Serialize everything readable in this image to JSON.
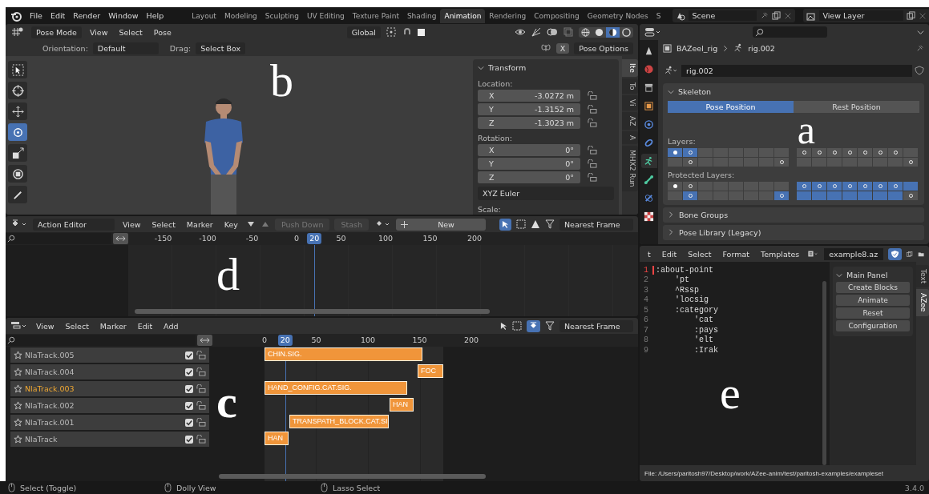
{
  "menu": [
    "File",
    "Edit",
    "Render",
    "Window",
    "Help"
  ],
  "workspaces": [
    {
      "label": "Layout",
      "selected": false
    },
    {
      "label": "Modeling",
      "selected": false
    },
    {
      "label": "Sculpting",
      "selected": false
    },
    {
      "label": "UV Editing",
      "selected": false
    },
    {
      "label": "Texture Paint",
      "selected": false
    },
    {
      "label": "Shading",
      "selected": false
    },
    {
      "label": "Animation",
      "selected": true
    },
    {
      "label": "Rendering",
      "selected": false
    },
    {
      "label": "Compositing",
      "selected": false
    },
    {
      "label": "Geometry Nodes",
      "selected": false
    },
    {
      "label": "S",
      "selected": false
    }
  ],
  "scene": "Scene",
  "view_layer": "View Layer",
  "viewport": {
    "mode": "Pose Mode",
    "menus": [
      "View",
      "Select",
      "Pose"
    ],
    "orientation": "Global",
    "shading_modes": [
      {
        "kind": "wireframe",
        "selected": false
      },
      {
        "kind": "solid",
        "selected": false
      },
      {
        "kind": "material",
        "selected": true
      },
      {
        "kind": "rendered",
        "selected": false
      }
    ],
    "tool_settings": {
      "orientation_label": "Orientation:",
      "orientation": "Default",
      "drag_label": "Drag:",
      "drag": "Select Box",
      "mirror": "X",
      "pose_options": "Pose Options"
    },
    "tools": [
      {
        "kind": "select",
        "selected": false
      },
      {
        "kind": "cursor",
        "selected": false
      },
      {
        "kind": "move",
        "selected": false
      },
      {
        "kind": "rotate",
        "selected": true
      },
      {
        "kind": "scale",
        "selected": false
      },
      {
        "kind": "transform",
        "selected": false
      },
      {
        "kind": "annotate",
        "selected": false
      }
    ],
    "annotation": "b",
    "sidebar_tabs": [
      {
        "label": "Ite",
        "selected": true
      },
      {
        "label": "To",
        "selected": false
      },
      {
        "label": "Vi",
        "selected": false
      },
      {
        "label": "AZ",
        "selected": false
      },
      {
        "label": "A",
        "selected": false
      },
      {
        "label": "MHX2 Run",
        "selected": false
      }
    ],
    "transform": {
      "title": "Transform",
      "location_label": "Location:",
      "location": [
        {
          "axis": "X",
          "value": "-3.0272 m"
        },
        {
          "axis": "Y",
          "value": "-1.3152 m"
        },
        {
          "axis": "Z",
          "value": "-1.3023 m"
        }
      ],
      "rotation_label": "Rotation:",
      "rotation": [
        {
          "axis": "X",
          "value": "0°"
        },
        {
          "axis": "Y",
          "value": "0°"
        },
        {
          "axis": "Z",
          "value": "0°"
        }
      ],
      "rotation_mode": "XYZ Euler",
      "scale_label": "Scale:"
    }
  },
  "properties": {
    "object": "BAZeel_rig",
    "data": "rig.002",
    "data_field": "rig.002",
    "tabs": [
      {
        "kind": "tool",
        "selected": false
      },
      {
        "kind": "world",
        "selected": false
      },
      {
        "kind": "collection",
        "selected": false
      },
      {
        "kind": "object",
        "selected": false
      },
      {
        "kind": "physics",
        "selected": false
      },
      {
        "kind": "constraint",
        "selected": false
      },
      {
        "kind": "armature",
        "selected": true
      },
      {
        "kind": "bone",
        "selected": false
      },
      {
        "kind": "bone_constraint",
        "selected": false
      },
      {
        "kind": "texture",
        "selected": false
      }
    ],
    "skeleton": {
      "title": "Skeleton",
      "positions": [
        {
          "label": "Pose Position",
          "selected": true
        },
        {
          "label": "Rest Position",
          "selected": false
        }
      ],
      "layers_label": "Layers:",
      "layers": [
        [
          [
            {
              "selected": true,
              "bones": true,
              "active": true
            },
            {
              "selected": true,
              "bones": true,
              "active": false
            },
            {
              "selected": false,
              "bones": false,
              "active": false
            },
            {
              "selected": false,
              "bones": false,
              "active": false
            },
            {
              "selected": false,
              "bones": false,
              "active": false
            },
            {
              "selected": false,
              "bones": false,
              "active": false
            },
            {
              "selected": false,
              "bones": false,
              "active": false
            },
            {
              "selected": false,
              "bones": false,
              "active": false
            }
          ],
          [
            {
              "selected": false,
              "bones": false,
              "active": false
            },
            {
              "selected": false,
              "bones": true,
              "active": false
            },
            {
              "selected": false,
              "bones": false,
              "active": false
            },
            {
              "selected": false,
              "bones": false,
              "active": false
            },
            {
              "selected": false,
              "bones": false,
              "active": false
            },
            {
              "selected": false,
              "bones": false,
              "active": false
            },
            {
              "selected": false,
              "bones": false,
              "active": false
            },
            {
              "selected": false,
              "bones": true,
              "active": false
            }
          ]
        ],
        [
          [
            {
              "selected": false,
              "bones": true,
              "active": false
            },
            {
              "selected": false,
              "bones": true,
              "active": false
            },
            {
              "selected": false,
              "bones": true,
              "active": false
            },
            {
              "selected": false,
              "bones": true,
              "active": false
            },
            {
              "selected": false,
              "bones": true,
              "active": false
            },
            {
              "selected": false,
              "bones": true,
              "active": false
            },
            {
              "selected": false,
              "bones": true,
              "active": false
            },
            {
              "selected": false,
              "bones": false,
              "active": false
            }
          ],
          [
            {
              "selected": false,
              "bones": false,
              "active": false
            },
            {
              "selected": false,
              "bones": false,
              "active": false
            },
            {
              "selected": false,
              "bones": false,
              "active": false
            },
            {
              "selected": false,
              "bones": false,
              "active": false
            },
            {
              "selected": false,
              "bones": false,
              "active": false
            },
            {
              "selected": false,
              "bones": false,
              "active": false
            },
            {
              "selected": false,
              "bones": false,
              "active": false
            },
            {
              "selected": false,
              "bones": true,
              "active": false
            }
          ]
        ]
      ],
      "protected_label": "Protected Layers:",
      "protected": [
        [
          [
            {
              "selected": false,
              "bones": true,
              "active": true
            },
            {
              "selected": false,
              "bones": true,
              "active": false
            },
            {
              "selected": false,
              "bones": false,
              "active": false
            },
            {
              "selected": false,
              "bones": false,
              "active": false
            },
            {
              "selected": false,
              "bones": false,
              "active": false
            },
            {
              "selected": false,
              "bones": false,
              "active": false
            },
            {
              "selected": false,
              "bones": false,
              "active": false
            },
            {
              "selected": false,
              "bones": false,
              "active": false
            }
          ],
          [
            {
              "selected": false,
              "bones": false,
              "active": false
            },
            {
              "selected": true,
              "bones": true,
              "active": false
            },
            {
              "selected": false,
              "bones": false,
              "active": false
            },
            {
              "selected": false,
              "bones": false,
              "active": false
            },
            {
              "selected": false,
              "bones": false,
              "active": false
            },
            {
              "selected": false,
              "bones": false,
              "active": false
            },
            {
              "selected": false,
              "bones": false,
              "active": false
            },
            {
              "selected": true,
              "bones": true,
              "active": false
            }
          ]
        ],
        [
          [
            {
              "selected": true,
              "bones": true,
              "active": false
            },
            {
              "selected": true,
              "bones": true,
              "active": false
            },
            {
              "selected": true,
              "bones": true,
              "active": false
            },
            {
              "selected": true,
              "bones": true,
              "active": false
            },
            {
              "selected": true,
              "bones": true,
              "active": false
            },
            {
              "selected": true,
              "bones": true,
              "active": false
            },
            {
              "selected": true,
              "bones": true,
              "active": false
            },
            {
              "selected": true,
              "bones": false,
              "active": false
            }
          ],
          [
            {
              "selected": true,
              "bones": false,
              "active": false
            },
            {
              "selected": true,
              "bones": false,
              "active": false
            },
            {
              "selected": true,
              "bones": false,
              "active": false
            },
            {
              "selected": true,
              "bones": false,
              "active": false
            },
            {
              "selected": true,
              "bones": false,
              "active": false
            },
            {
              "selected": true,
              "bones": false,
              "active": false
            },
            {
              "selected": true,
              "bones": false,
              "active": false
            },
            {
              "selected": false,
              "bones": true,
              "active": false
            }
          ]
        ]
      ]
    },
    "collapsed_panels": [
      "Bone Groups",
      "Pose Library (Legacy)"
    ],
    "annotation": "a"
  },
  "action_editor": {
    "editor": "Action Editor",
    "menus": [
      "View",
      "Select",
      "Marker",
      "Key"
    ],
    "push_down": {
      "label": "Push Down",
      "disabled": true
    },
    "stash": {
      "label": "Stash",
      "disabled": true
    },
    "new": "New",
    "snap": "Nearest Frame",
    "ticks": [
      "-150",
      "-100",
      "-50",
      "0",
      "50",
      "100",
      "150",
      "200"
    ],
    "current_frame": "20",
    "annotation": "d"
  },
  "nla": {
    "menus": [
      "View",
      "Select",
      "Marker",
      "Edit",
      "Add"
    ],
    "snap": "Nearest Frame",
    "ticks": [
      "0",
      "50",
      "100",
      "150",
      "200"
    ],
    "current_frame": "20",
    "annotation": "c",
    "tracks": [
      {
        "name": "NlaTrack.005",
        "selected": false,
        "checked": true,
        "strips": [
          {
            "label": "CHIN.SIG."
          }
        ]
      },
      {
        "name": "NlaTrack.004",
        "selected": false,
        "checked": true,
        "strips": [
          {
            "label": "FOC"
          }
        ]
      },
      {
        "name": "NlaTrack.003",
        "selected": true,
        "checked": true,
        "strips": [
          {
            "label": "HAND_CONFIG.CAT.SIG."
          }
        ]
      },
      {
        "name": "NlaTrack.002",
        "selected": false,
        "checked": true,
        "strips": [
          {
            "label": "HAN"
          }
        ]
      },
      {
        "name": "NlaTrack.001",
        "selected": false,
        "checked": true,
        "strips": [
          {
            "label": "TRANSPATH_BLOCK.CAT.SI"
          }
        ]
      },
      {
        "name": "NlaTrack",
        "selected": false,
        "checked": true,
        "strips": [
          {
            "label": "HAN"
          }
        ]
      }
    ]
  },
  "text_editor": {
    "menus": [
      "t",
      "Edit",
      "Select",
      "Format",
      "Templates"
    ],
    "file": "example8.az",
    "lines": [
      {
        "number": "1",
        "text": ":about-point",
        "current": true
      },
      {
        "number": "2",
        "text": "    'pt",
        "current": false
      },
      {
        "number": "3",
        "text": "    ^Rssp",
        "current": false
      },
      {
        "number": "4",
        "text": "    'locsig",
        "current": false
      },
      {
        "number": "5",
        "text": "    :category",
        "current": false
      },
      {
        "number": "6",
        "text": "        'cat",
        "current": false
      },
      {
        "number": "7",
        "text": "        :pays",
        "current": false
      },
      {
        "number": "8",
        "text": "        'elt",
        "current": false
      },
      {
        "number": "9",
        "text": "        :Irak",
        "current": false
      }
    ],
    "panel": {
      "title": "Main Panel",
      "buttons": [
        "Create Blocks",
        "Animate",
        "Reset",
        "Configuration"
      ]
    },
    "tabs": [
      {
        "label": "Text",
        "selected": false
      },
      {
        "label": "AZee",
        "selected": true
      }
    ],
    "file_path": "File: /Users/paritosh97/Desktop/work/AZee-anim/test/paritosh-examples/exampleset",
    "annotation": "e"
  },
  "status_bar": {
    "items": [
      "Select (Toggle)",
      "Dolly View",
      "Lasso Select"
    ],
    "version": "3.4.0"
  }
}
